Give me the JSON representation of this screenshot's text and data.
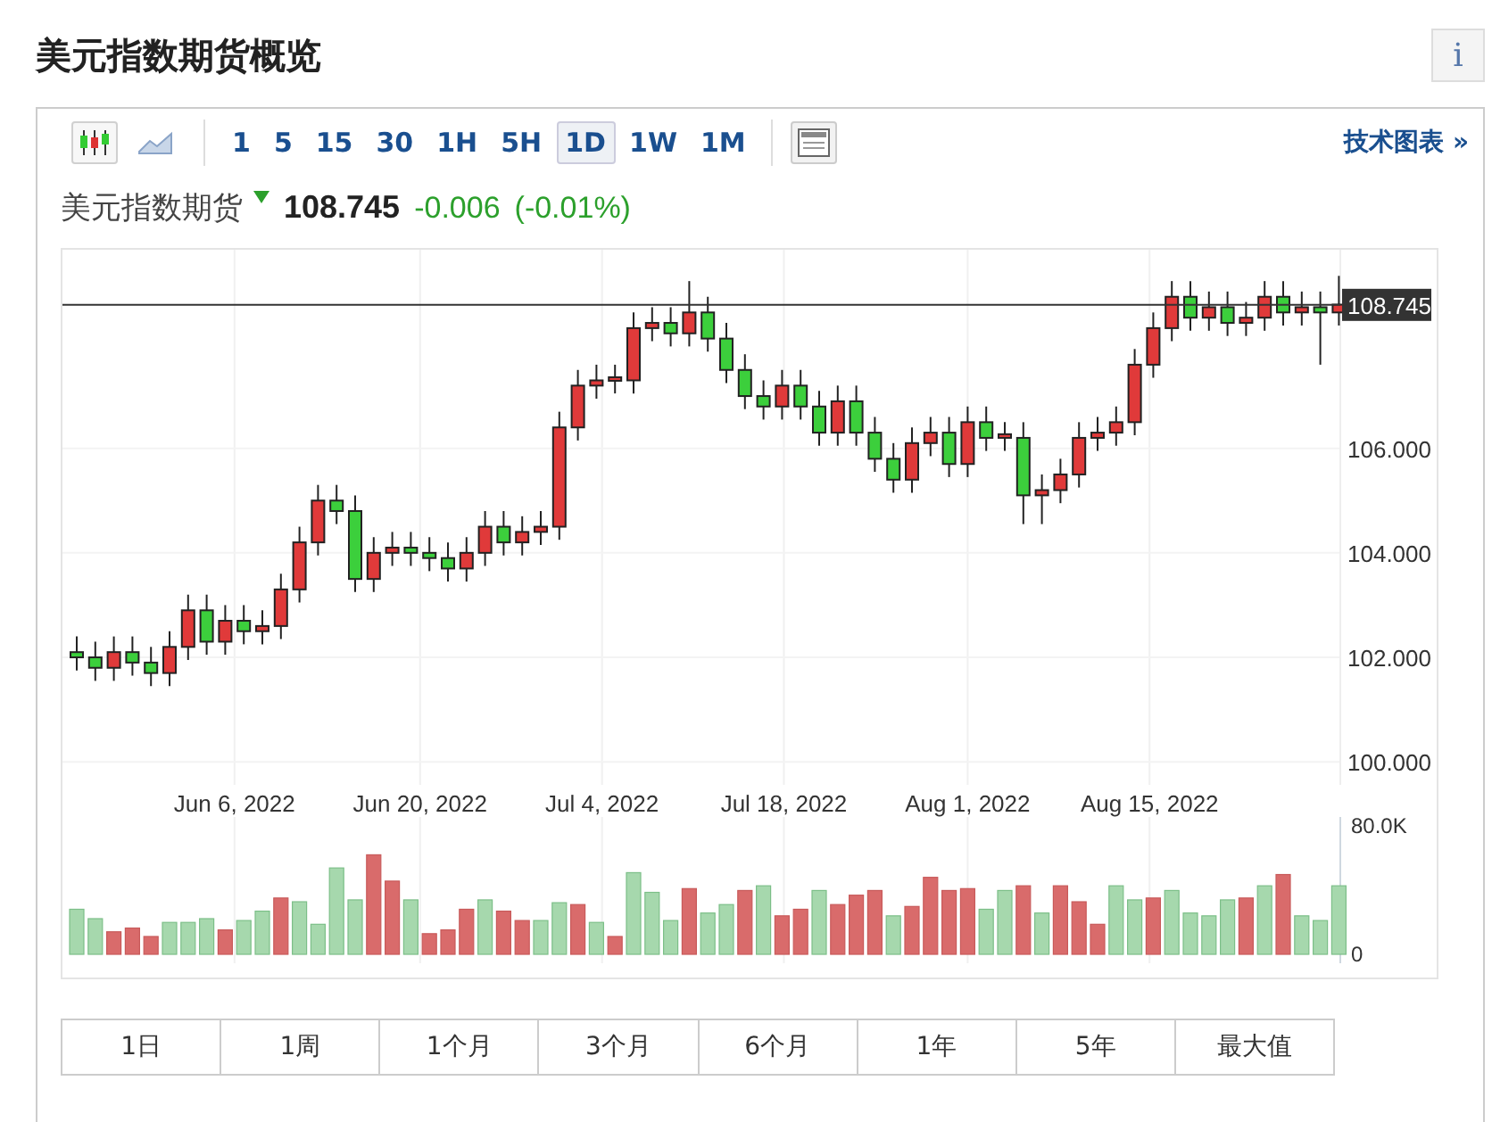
{
  "header": {
    "title": "美元指数期货概览",
    "info_button": "i"
  },
  "toolbar": {
    "chart_types": [
      {
        "kind": "candles",
        "selected": true
      },
      {
        "kind": "area",
        "selected": false
      }
    ],
    "intervals": [
      {
        "label": "1",
        "selected": false
      },
      {
        "label": "5",
        "selected": false
      },
      {
        "label": "15",
        "selected": false
      },
      {
        "label": "30",
        "selected": false
      },
      {
        "label": "1H",
        "selected": false
      },
      {
        "label": "5H",
        "selected": false
      },
      {
        "label": "1D",
        "selected": true
      },
      {
        "label": "1W",
        "selected": false
      },
      {
        "label": "1M",
        "selected": false
      }
    ],
    "link": "技术图表 »"
  },
  "quote": {
    "name": "美元指数期货",
    "price": "108.745",
    "change": "-0.006",
    "change_pct": "(-0.01%)"
  },
  "chart": {
    "volume_labels": [
      "80.0K",
      "0"
    ],
    "date_labels": [
      "Jun 6, 2022",
      "Jun 20, 2022",
      "Jul 4, 2022",
      "Jul 18, 2022",
      "Aug 1, 2022",
      "Aug 15, 2022"
    ],
    "chart_data": {
      "type": "candlestick",
      "grid": true,
      "ylim": [
        99.56,
        109.8
      ],
      "ref_lines": [
        {
          "axis": "y",
          "value": 108.745,
          "label": "108.745"
        }
      ],
      "yticks": [
        {
          "value": 106,
          "label": "106.000"
        },
        {
          "value": 104,
          "label": "104.000"
        },
        {
          "value": 102,
          "label": "102.000"
        },
        {
          "value": 100,
          "label": "100.000"
        }
      ],
      "ohlc": [
        [
          102.1,
          102.4,
          101.75,
          102.0
        ],
        [
          102.0,
          102.3,
          101.55,
          101.8
        ],
        [
          101.8,
          102.4,
          101.55,
          102.1
        ],
        [
          102.1,
          102.4,
          101.65,
          101.9
        ],
        [
          101.9,
          102.2,
          101.45,
          101.7
        ],
        [
          101.7,
          102.5,
          101.45,
          102.2
        ],
        [
          102.2,
          103.2,
          101.95,
          102.9
        ],
        [
          102.9,
          103.2,
          102.05,
          102.3
        ],
        [
          102.3,
          103.0,
          102.05,
          102.7
        ],
        [
          102.7,
          103.0,
          102.25,
          102.5
        ],
        [
          102.5,
          102.9,
          102.25,
          102.6
        ],
        [
          102.6,
          103.6,
          102.35,
          103.3
        ],
        [
          103.3,
          104.5,
          103.05,
          104.2
        ],
        [
          104.2,
          105.3,
          103.95,
          105.0
        ],
        [
          105.0,
          105.3,
          104.55,
          104.8
        ],
        [
          104.8,
          105.1,
          103.25,
          103.5
        ],
        [
          103.5,
          104.3,
          103.25,
          104.0
        ],
        [
          104.0,
          104.4,
          103.75,
          104.1
        ],
        [
          104.1,
          104.4,
          103.75,
          104.0
        ],
        [
          104.0,
          104.3,
          103.65,
          103.9
        ],
        [
          103.9,
          104.2,
          103.45,
          103.7
        ],
        [
          103.7,
          104.3,
          103.45,
          104.0
        ],
        [
          104.0,
          104.8,
          103.75,
          104.5
        ],
        [
          104.5,
          104.8,
          103.95,
          104.2
        ],
        [
          104.2,
          104.7,
          103.95,
          104.4
        ],
        [
          104.4,
          104.8,
          104.15,
          104.5
        ],
        [
          104.5,
          106.7,
          104.25,
          106.4
        ],
        [
          106.4,
          107.5,
          106.15,
          107.2
        ],
        [
          107.2,
          107.6,
          106.95,
          107.3
        ],
        [
          107.3,
          107.6,
          107.05,
          107.36
        ],
        [
          107.3,
          108.6,
          107.05,
          108.3
        ],
        [
          108.3,
          108.7,
          108.05,
          108.4
        ],
        [
          108.4,
          108.7,
          107.95,
          108.2
        ],
        [
          108.2,
          109.2,
          107.95,
          108.6
        ],
        [
          108.6,
          108.9,
          107.85,
          108.1
        ],
        [
          108.1,
          108.4,
          107.25,
          107.5
        ],
        [
          107.5,
          107.8,
          106.75,
          107.0
        ],
        [
          107.0,
          107.3,
          106.55,
          106.8
        ],
        [
          106.8,
          107.5,
          106.55,
          107.2
        ],
        [
          107.2,
          107.5,
          106.55,
          106.8
        ],
        [
          106.8,
          107.1,
          106.05,
          106.3
        ],
        [
          106.3,
          107.2,
          106.05,
          106.9
        ],
        [
          106.9,
          107.2,
          106.05,
          106.3
        ],
        [
          106.3,
          106.6,
          105.55,
          105.8
        ],
        [
          105.8,
          106.1,
          105.15,
          105.4
        ],
        [
          105.4,
          106.4,
          105.15,
          106.1
        ],
        [
          106.1,
          106.6,
          105.85,
          106.3
        ],
        [
          106.3,
          106.6,
          105.45,
          105.7
        ],
        [
          105.7,
          106.8,
          105.45,
          106.5
        ],
        [
          106.5,
          106.8,
          105.95,
          106.2
        ],
        [
          106.2,
          106.5,
          105.95,
          106.27
        ],
        [
          106.2,
          106.5,
          104.55,
          105.1
        ],
        [
          105.1,
          105.5,
          104.55,
          105.2
        ],
        [
          105.2,
          105.8,
          104.95,
          105.5
        ],
        [
          105.5,
          106.5,
          105.25,
          106.2
        ],
        [
          106.2,
          106.6,
          105.95,
          106.3
        ],
        [
          106.3,
          106.8,
          106.05,
          106.5
        ],
        [
          106.5,
          107.9,
          106.25,
          107.6
        ],
        [
          107.6,
          108.6,
          107.35,
          108.3
        ],
        [
          108.3,
          109.2,
          108.05,
          108.9
        ],
        [
          108.9,
          109.2,
          108.25,
          108.5
        ],
        [
          108.5,
          109.0,
          108.25,
          108.7
        ],
        [
          108.7,
          109.0,
          108.15,
          108.4
        ],
        [
          108.4,
          108.8,
          108.15,
          108.5
        ],
        [
          108.5,
          109.2,
          108.25,
          108.9
        ],
        [
          108.9,
          109.2,
          108.35,
          108.6
        ],
        [
          108.6,
          109.0,
          108.35,
          108.7
        ],
        [
          108.7,
          109.0,
          107.6,
          108.6
        ],
        [
          108.6,
          109.3,
          108.35,
          108.75
        ]
      ]
    }
  },
  "ranges": [
    {
      "label": "1日",
      "selected": false
    },
    {
      "label": "1周",
      "selected": false
    },
    {
      "label": "1个月",
      "selected": false
    },
    {
      "label": "3个月",
      "selected": false
    },
    {
      "label": "6个月",
      "selected": false
    },
    {
      "label": "1年",
      "selected": false
    },
    {
      "label": "5年",
      "selected": false
    },
    {
      "label": "最大值",
      "selected": false
    }
  ]
}
